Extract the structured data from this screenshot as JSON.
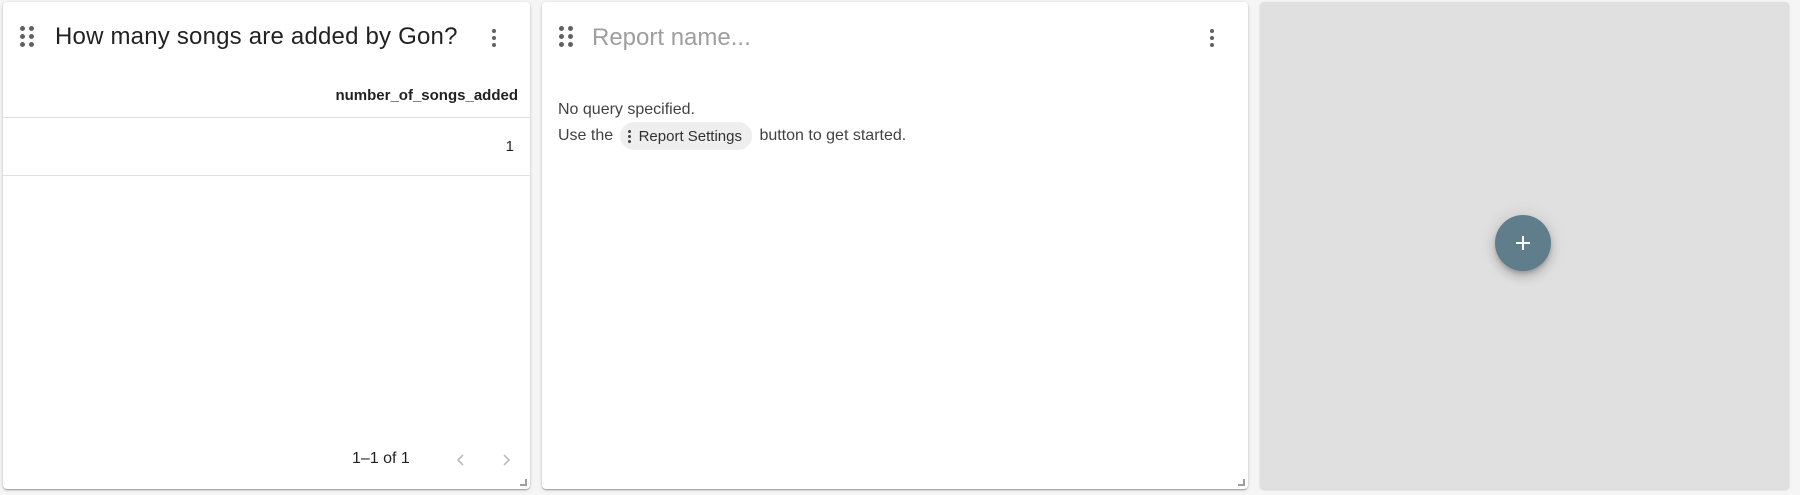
{
  "report_cards": [
    {
      "title": "How many songs are added by Gon?",
      "table": {
        "columns": [
          "number_of_songs_added"
        ],
        "rows": [
          [
            "1"
          ]
        ]
      },
      "pagination": {
        "range_text": "1–1 of 1"
      }
    },
    {
      "title_placeholder": "Report name...",
      "empty_message": {
        "line1": "No query specified.",
        "line2_prefix": "Use the",
        "chip_label": "Report Settings",
        "line2_suffix": "button to get started."
      }
    }
  ],
  "add_card": {
    "fab_icon": "plus-icon"
  },
  "colors": {
    "fab_background": "#607d8b",
    "placeholder_panel": "#e0e0e0"
  },
  "icons": {
    "drag_handle": "drag-handle-icon",
    "menu": "more-vert-icon",
    "prev": "chevron-left-icon",
    "next": "chevron-right-icon"
  }
}
